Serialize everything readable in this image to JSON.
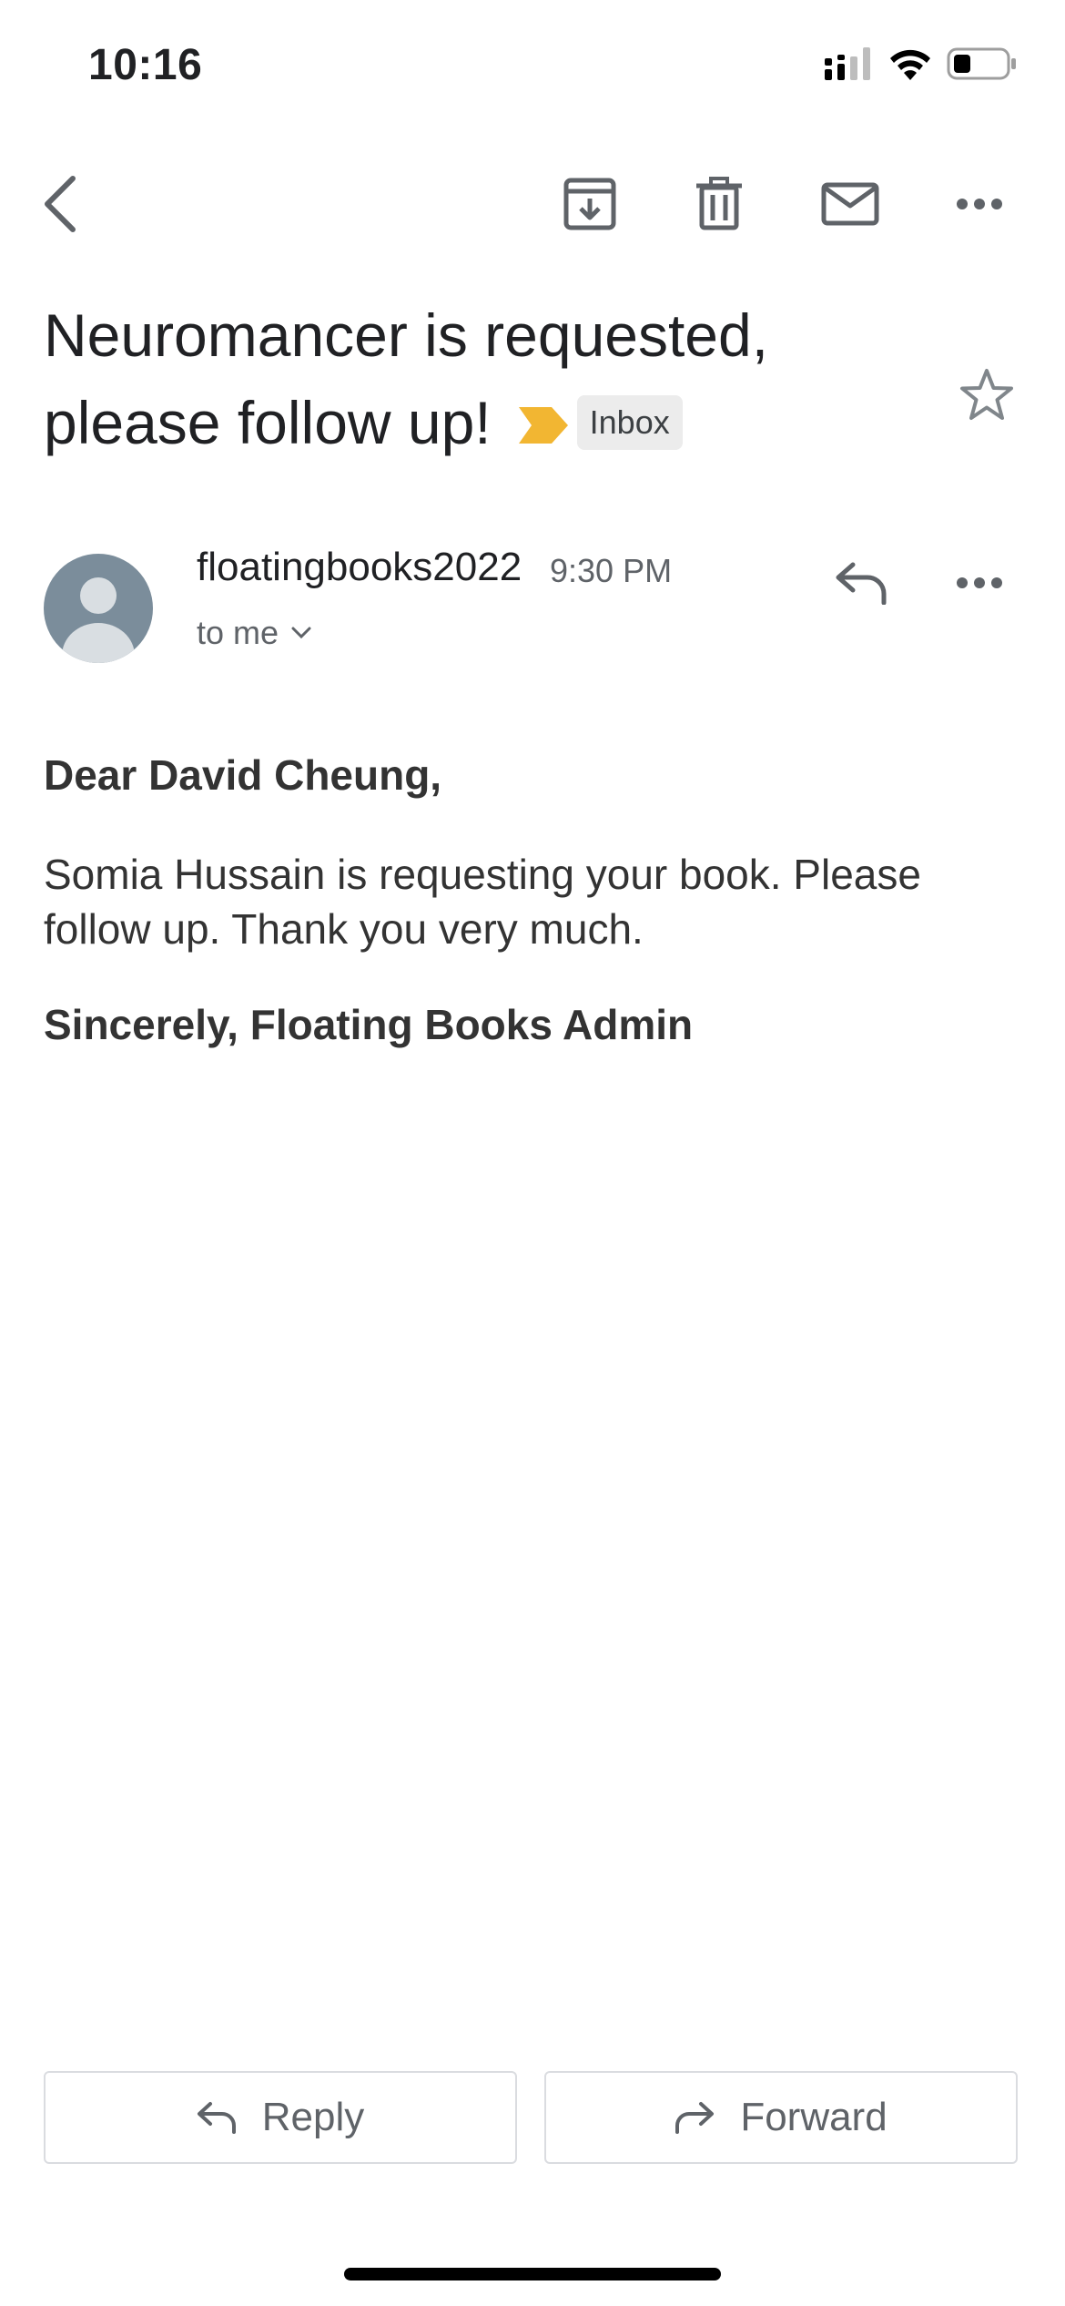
{
  "status_bar": {
    "time": "10:16",
    "icons": [
      "cellular-signal-icon",
      "wifi-icon",
      "battery-icon"
    ]
  },
  "toolbar": {
    "icons": [
      "back-icon",
      "archive-icon",
      "delete-icon",
      "mark-unread-icon",
      "more-icon"
    ]
  },
  "email": {
    "subject": "Neuromancer is requested, please follow up!",
    "label": "Inbox",
    "importance_color": "#F2B632",
    "sender": "floatingbooks2022",
    "time": "9:30 PM",
    "recipient": "to me",
    "greeting": "Dear David Cheung,",
    "body": "Somia Hussain is requesting your book. Please follow up. Thank you very much.",
    "signoff": "Sincerely, Floating Books Admin"
  },
  "actions": {
    "reply_label": "Reply",
    "forward_label": "Forward"
  }
}
